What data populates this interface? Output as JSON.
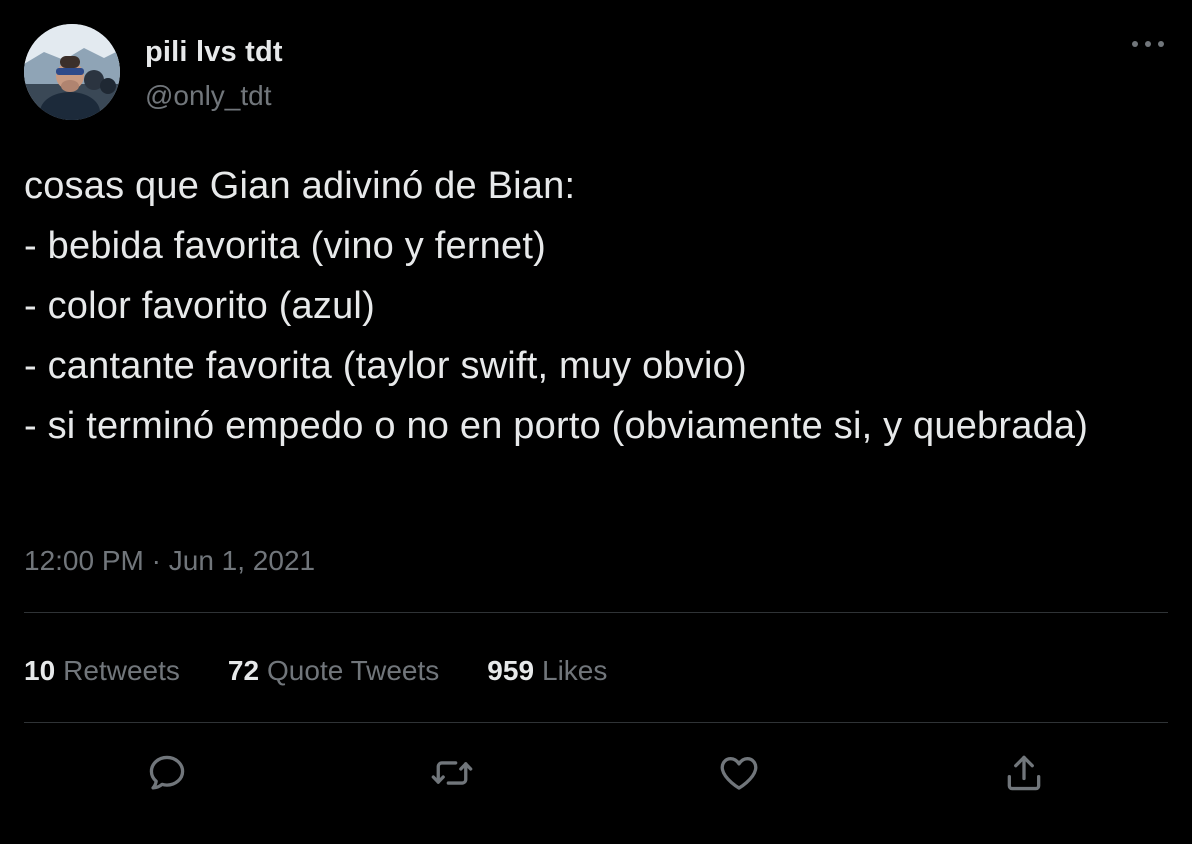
{
  "author": {
    "display_name": "pili lvs tdt",
    "handle": "@only_tdt"
  },
  "tweet": {
    "text": "cosas que Gian adivinó de Bian:\n- bebida favorita (vino y fernet)\n- color favorito (azul)\n- cantante favorita (taylor swift, muy obvio)\n- si terminó empedo o no en porto (obviamente si, y quebrada)",
    "time": "12:00 PM",
    "separator": "·",
    "date": "Jun 1, 2021"
  },
  "stats": {
    "retweets_count": "10",
    "retweets_label": "Retweets",
    "quotes_count": "72",
    "quotes_label": "Quote Tweets",
    "likes_count": "959",
    "likes_label": "Likes"
  },
  "actions": {
    "reply_icon": "reply-icon",
    "retweet_icon": "retweet-icon",
    "like_icon": "heart-icon",
    "share_icon": "share-icon"
  },
  "colors": {
    "background": "#000000",
    "primary_text": "#e7e9ea",
    "secondary_text": "#71767b",
    "divider": "#2f3336"
  }
}
